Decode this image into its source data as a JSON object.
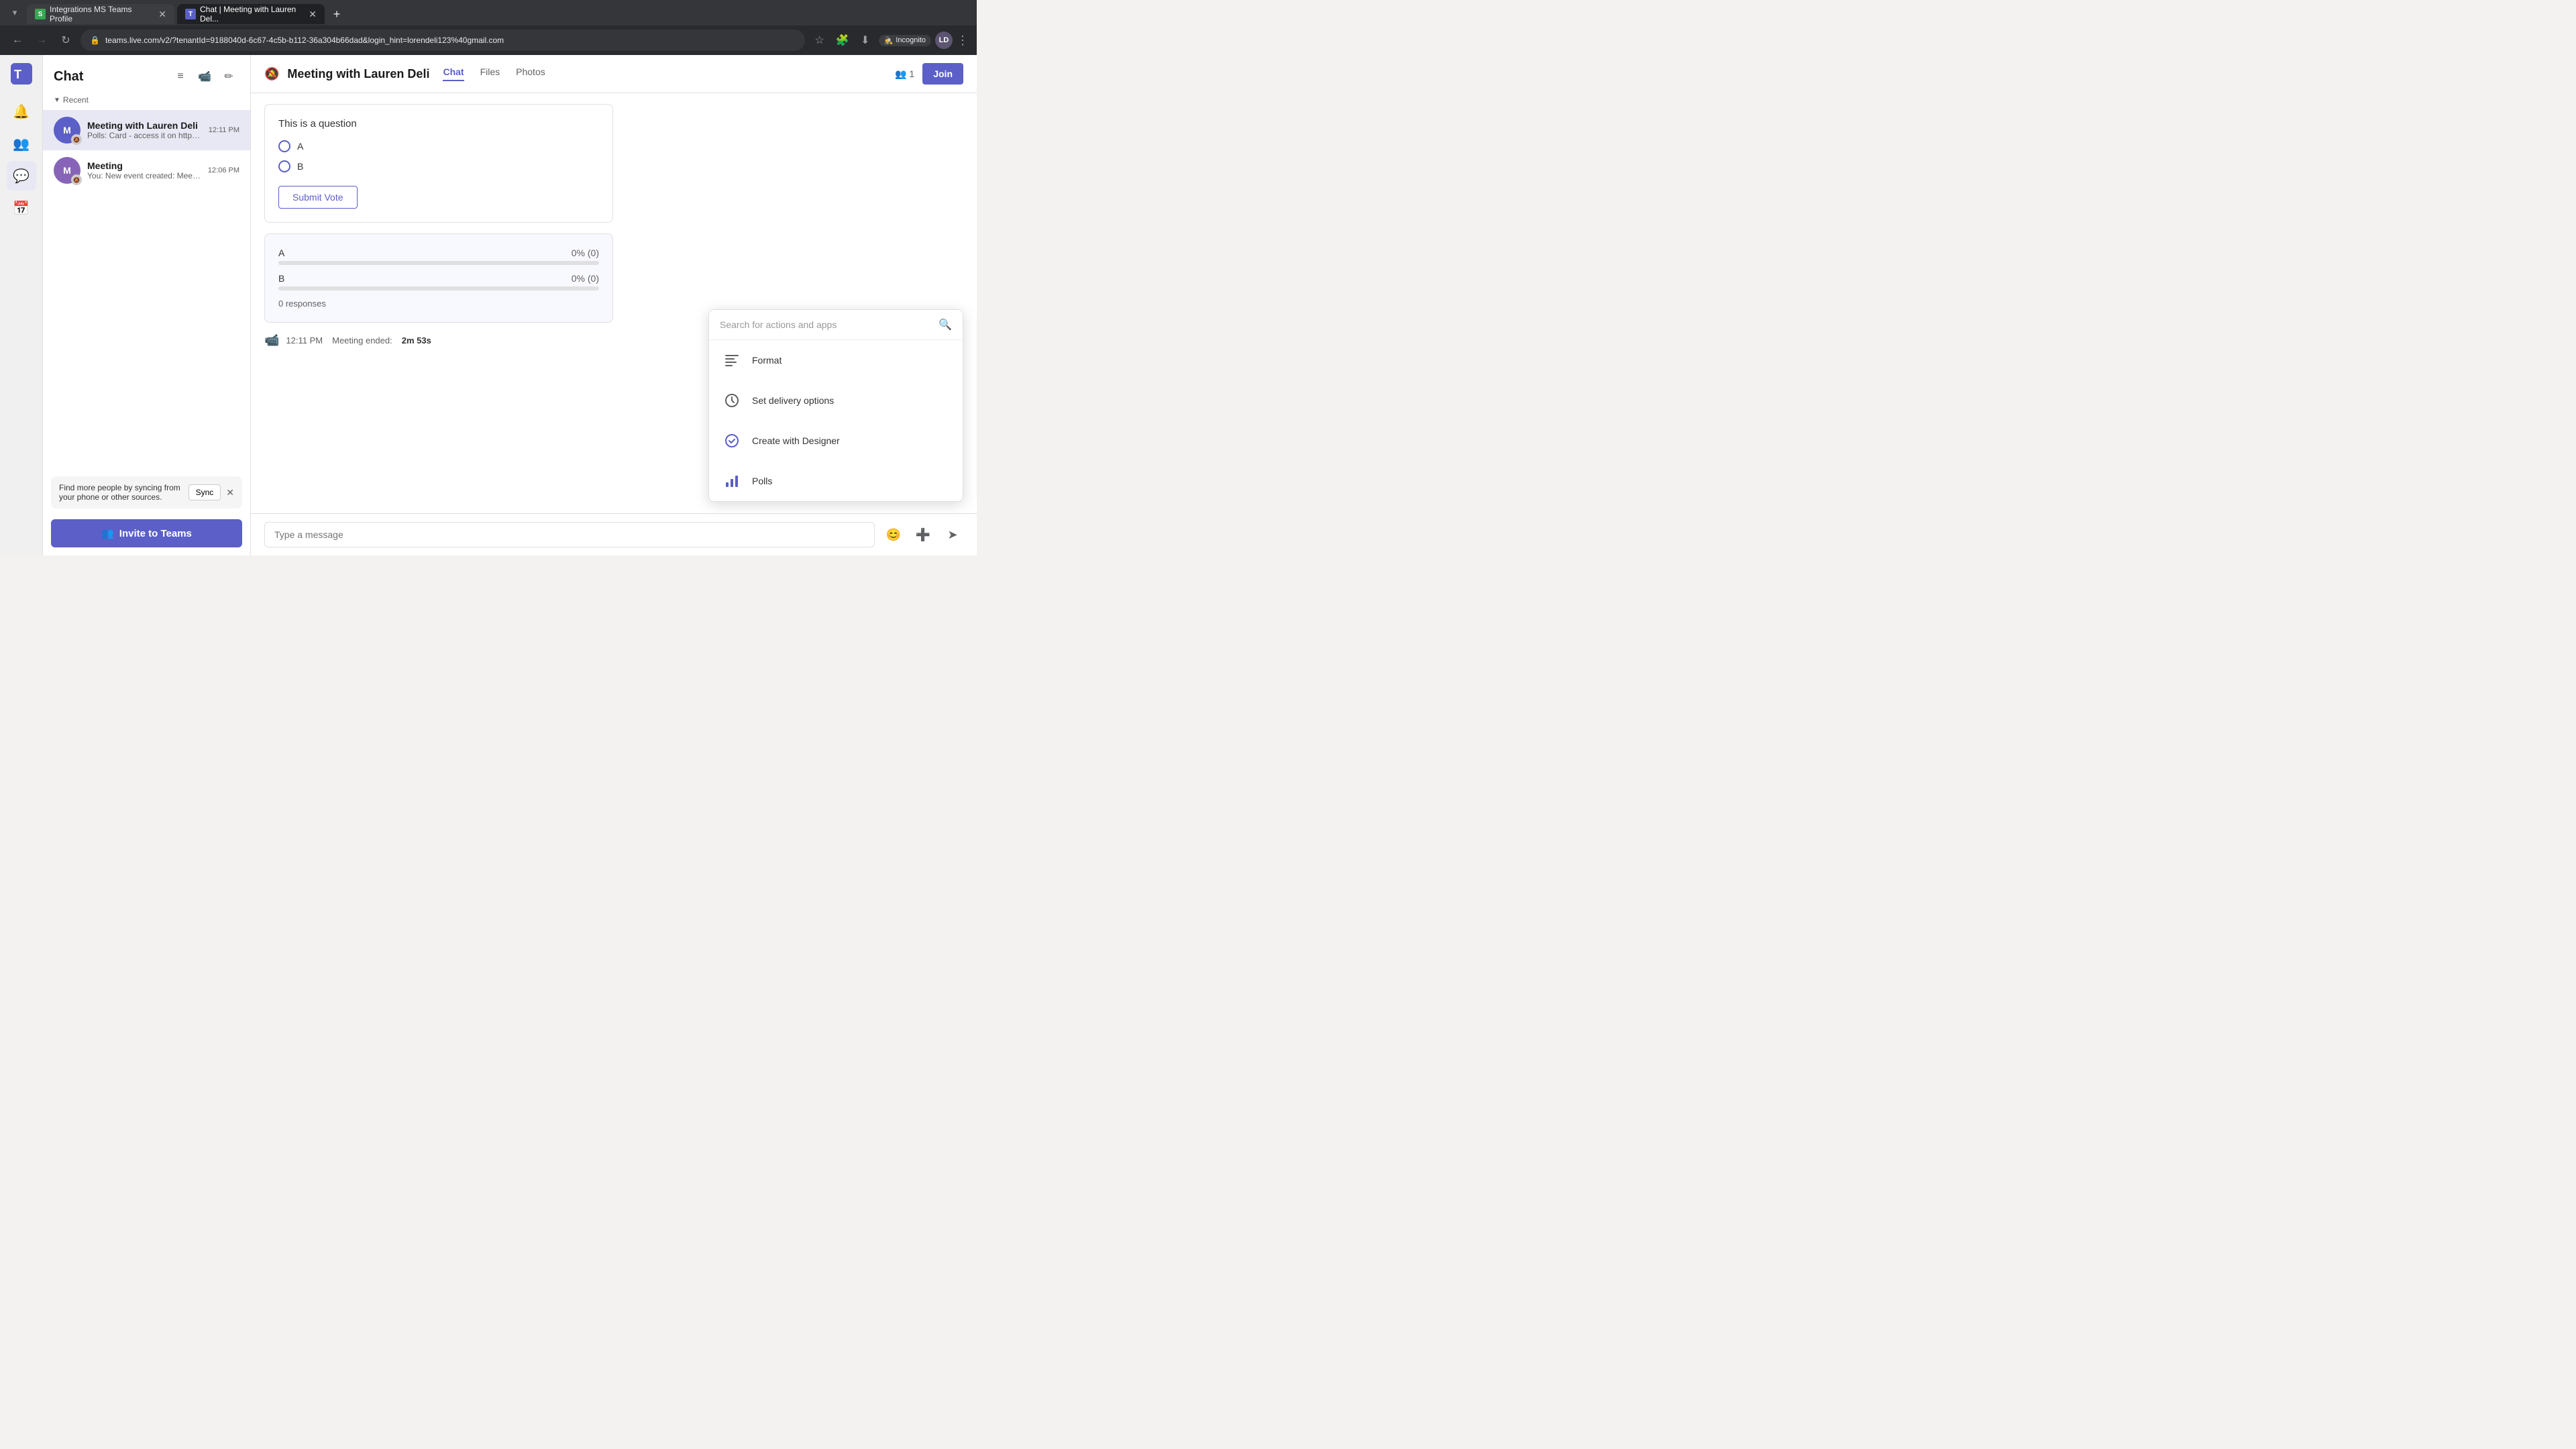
{
  "browser": {
    "tabs": [
      {
        "id": "tab1",
        "favicon": "S",
        "favicon_color": "#34a853",
        "label": "Integrations MS Teams Profile",
        "active": false
      },
      {
        "id": "tab2",
        "favicon": "T",
        "favicon_color": "#5b5fc7",
        "label": "Chat | Meeting with Lauren Del...",
        "active": true
      }
    ],
    "address": "teams.live.com/v2/?tenantId=9188040d-6c67-4c5b-b112-36a304b66dad&login_hint=lorendeli123%40gmail.com",
    "incognito_label": "Incognito",
    "user_initials": "LD"
  },
  "sidebar": {
    "title": "Chat",
    "icons": [
      {
        "name": "bell",
        "symbol": "🔔"
      },
      {
        "name": "people",
        "symbol": "👥"
      },
      {
        "name": "chat",
        "symbol": "💬"
      },
      {
        "name": "calendar",
        "symbol": "📅"
      }
    ]
  },
  "chat_sidebar": {
    "title": "Chat",
    "recent_label": "Recent",
    "chats": [
      {
        "name": "Meeting with Lauren Deli",
        "preview": "Polls: Card - access it on https://go....",
        "time": "12:11 PM",
        "active": true
      },
      {
        "name": "Meeting",
        "preview": "You: New event created: Meeting",
        "time": "12:06 PM",
        "active": false
      }
    ],
    "sync_banner": {
      "text": "Find more people by syncing from your phone or other sources.",
      "sync_btn": "Sync"
    },
    "invite_btn": "Invite to Teams"
  },
  "main_chat": {
    "header": {
      "title": "Meeting with Lauren Deli",
      "bell_tooltip": "Mute notifications",
      "tabs": [
        "Chat",
        "Files",
        "Photos"
      ],
      "active_tab": "Chat",
      "participants_count": "1",
      "join_btn": "Join"
    },
    "poll_question_card": {
      "question": "This is a question",
      "options": [
        "A",
        "B"
      ],
      "submit_btn": "Submit Vote"
    },
    "poll_results_card": {
      "options": [
        {
          "label": "A",
          "pct": "0%",
          "pct_detail": "0% (0)",
          "value": 0
        },
        {
          "label": "B",
          "pct": "0%",
          "pct_detail": "0% (0)",
          "value": 0
        }
      ],
      "responses": "0 responses"
    },
    "meeting_ended": {
      "time": "12:11 PM",
      "label": "Meeting ended:",
      "duration": "2m 53s"
    },
    "message_input_placeholder": "Type a message"
  },
  "actions_dropdown": {
    "search_placeholder": "Search for actions and apps",
    "items": [
      {
        "name": "Format",
        "icon": "format"
      },
      {
        "name": "Set delivery options",
        "icon": "delivery"
      },
      {
        "name": "Create with Designer",
        "icon": "designer"
      },
      {
        "name": "Polls",
        "icon": "polls"
      }
    ]
  }
}
